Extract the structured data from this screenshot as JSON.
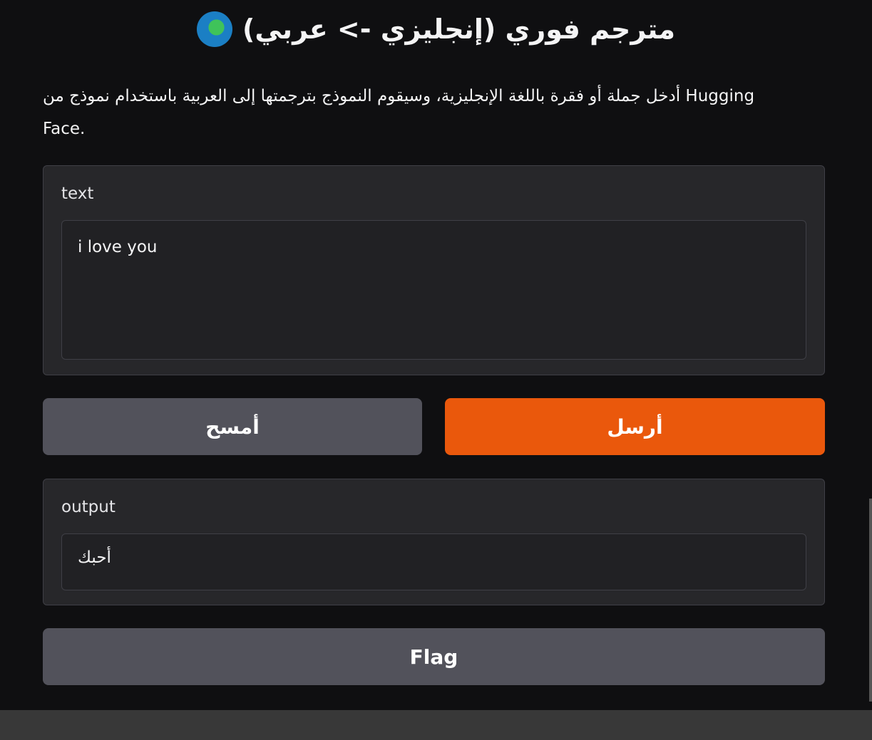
{
  "header": {
    "title": "مترجم فوري (إنجليزي -> عربي)",
    "icon": "globe-africa-icon"
  },
  "description": "أدخل جملة أو فقرة باللغة الإنجليزية، وسيقوم النموذج بترجمتها إلى العربية باستخدام نموذج من Hugging Face.",
  "input": {
    "label": "text",
    "value": "i love you"
  },
  "buttons": {
    "clear": "أمسح",
    "submit": "أرسل",
    "flag": "Flag"
  },
  "output": {
    "label": "output",
    "value": "أحبك"
  },
  "colors": {
    "accent": "#ea580c",
    "secondary": "#52525b"
  }
}
